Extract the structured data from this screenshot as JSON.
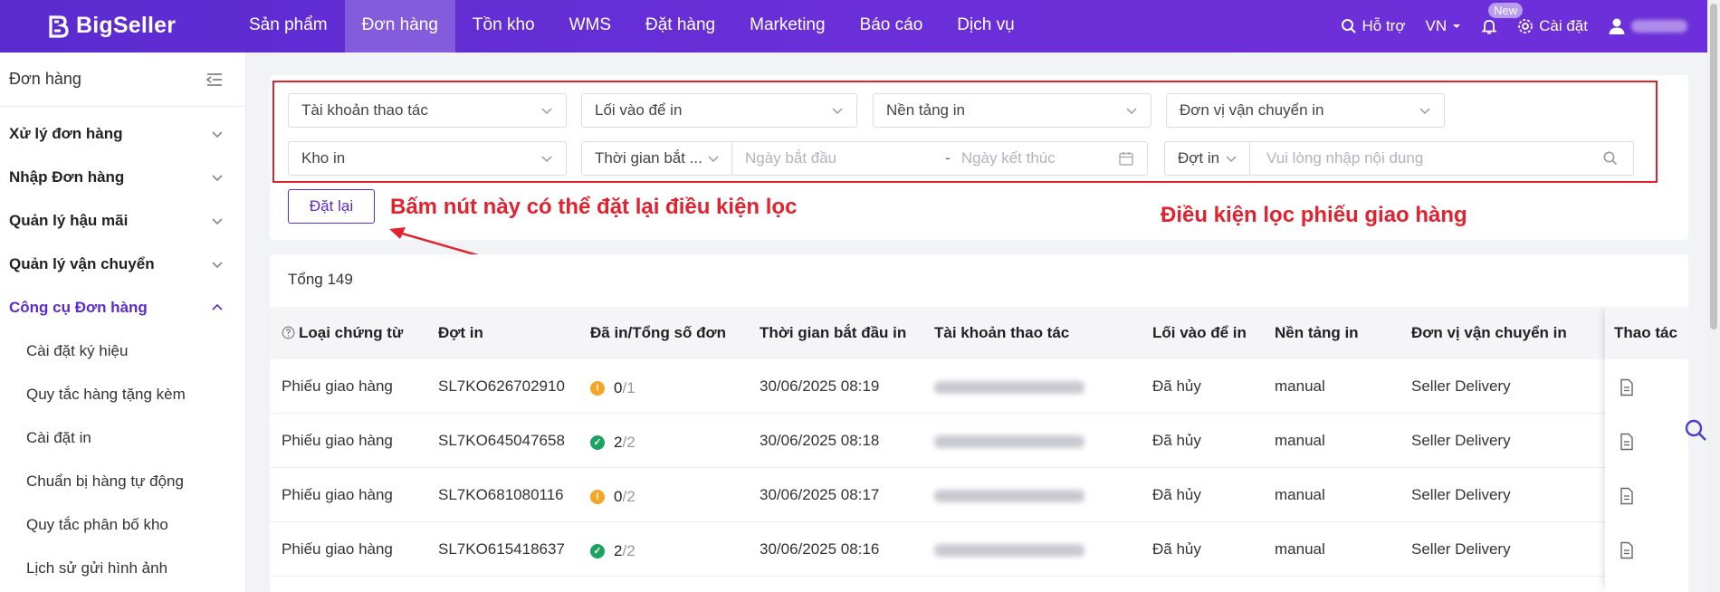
{
  "app": {
    "logo_text": "BigSeller"
  },
  "nav": {
    "items": [
      "Sản phẩm",
      "Đơn hàng",
      "Tồn kho",
      "WMS",
      "Đặt hàng",
      "Marketing",
      "Báo cáo",
      "Dịch vụ"
    ],
    "active": "Đơn hàng"
  },
  "top_right": {
    "support_label": "Hỗ trợ",
    "language": "VN",
    "notify_badge": "New",
    "settings_label": "Cài đặt"
  },
  "sidebar": {
    "title": "Đơn hàng",
    "groups": [
      "Xử lý đơn hàng",
      "Nhập Đơn hàng",
      "Quản lý hậu mãi",
      "Quản lý vận chuyển",
      "Công cụ Đơn hàng"
    ],
    "sub_items": [
      "Cài đặt ký hiệu",
      "Quy tắc hàng tặng kèm",
      "Cài đặt in",
      "Chuẩn bị hàng tự động",
      "Quy tắc phân bố kho",
      "Lịch sử gửi hình ảnh"
    ]
  },
  "filters": {
    "operator_account": "Tài khoản thao tác",
    "print_entry": "Lối vào để in",
    "print_platform": "Nền tảng in",
    "print_carrier": "Đơn vị vận chuyển in",
    "print_warehouse": "Kho in",
    "time_type": "Thời gian bắt ...",
    "start_date_placeholder": "Ngày bắt đầu",
    "date_separator": "-",
    "end_date_placeholder": "Ngày kết thúc",
    "search_type": "Đợt in",
    "search_placeholder": "Vui lòng nhập nội dung",
    "reset_label": "Đặt lại"
  },
  "annotations": {
    "reset_note": "Bấm nút này có thể đặt lại điều kiện lọc",
    "filter_note": "Điều kiện lọc phiếu giao hàng"
  },
  "table": {
    "total_label": "Tổng 149",
    "columns": [
      "Loại chứng từ",
      "Đợt in",
      "Đã in/Tổng số đơn",
      "Thời gian bắt đầu in",
      "Tài khoản thao tác",
      "Lối vào để in",
      "Nền tảng in",
      "Đơn vị vận chuyển in",
      "Thao tác"
    ],
    "rows": [
      {
        "doc_type": "Phiếu giao hàng",
        "batch": "SL7KO626702910",
        "printed": "0",
        "total": "1",
        "status": "warning",
        "start_time": "30/06/2025 08:19",
        "account": "2690803127@qq.com",
        "entry": "Đã hủy",
        "platform": "manual",
        "carrier": "Seller Delivery"
      },
      {
        "doc_type": "Phiếu giao hàng",
        "batch": "SL7KO645047658",
        "printed": "2",
        "total": "2",
        "status": "success",
        "start_time": "30/06/2025 08:18",
        "account": "2690803127@qq.com",
        "entry": "Đã hủy",
        "platform": "manual",
        "carrier": "Seller Delivery"
      },
      {
        "doc_type": "Phiếu giao hàng",
        "batch": "SL7KO681080116",
        "printed": "0",
        "total": "2",
        "status": "warning",
        "start_time": "30/06/2025 08:17",
        "account": "2690803127@qq.com",
        "entry": "Đã hủy",
        "platform": "manual",
        "carrier": "Seller Delivery"
      },
      {
        "doc_type": "Phiếu giao hàng",
        "batch": "SL7KO615418637",
        "printed": "2",
        "total": "2",
        "status": "success",
        "start_time": "30/06/2025 08:16",
        "account": "2690803127@qq.com",
        "entry": "Đã hủy",
        "platform": "manual",
        "carrier": "Seller Delivery"
      }
    ]
  },
  "colors": {
    "brand": "#5b2bd0",
    "annotation": "#e0232f",
    "warning": "#f5a623",
    "success": "#1aa260"
  }
}
